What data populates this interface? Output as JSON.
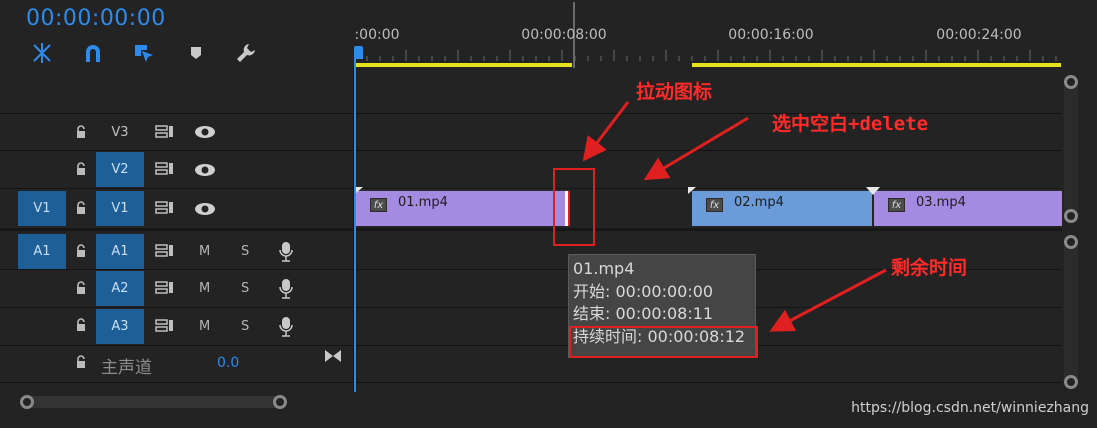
{
  "header": {
    "timecode": "00:00:00:00",
    "tools": [
      {
        "icon": "snap-insert-icon"
      },
      {
        "icon": "magnet-icon"
      },
      {
        "icon": "linked-selection-icon"
      },
      {
        "icon": "add-marker-icon"
      },
      {
        "icon": "wrench-icon"
      }
    ]
  },
  "ruler": {
    "labels": [
      ":00:00",
      "00:00:08:00",
      "00:00:16:00",
      "00:00:24:00"
    ]
  },
  "tracks": {
    "video": [
      {
        "source": "",
        "target": "V3"
      },
      {
        "source": "",
        "target": "V2"
      },
      {
        "source": "V1",
        "target": "V1"
      }
    ],
    "audio": [
      {
        "source": "A1",
        "target": "A1",
        "m": "M",
        "s": "S"
      },
      {
        "source": "",
        "target": "A2",
        "m": "M",
        "s": "S"
      },
      {
        "source": "",
        "target": "A3",
        "m": "M",
        "s": "S"
      }
    ],
    "master": {
      "label": "主声道",
      "value": "0.0"
    }
  },
  "clips": [
    {
      "name": "01.mp4",
      "fx": "fx"
    },
    {
      "name": "02.mp4",
      "fx": "fx"
    },
    {
      "name": "03.mp4",
      "fx": "fx"
    }
  ],
  "tooltip": {
    "name": "01.mp4",
    "start": "开始: 00:00:00:00",
    "end": "结束: 00:00:08:11",
    "duration": "持续时间: 00:00:08:12"
  },
  "annotations": {
    "drag_icon": "拉动图标",
    "select_blank": "选中空白+delete",
    "remaining_time": "剩余时间"
  },
  "watermark": "https://blog.csdn.net/winniezhang",
  "colors": {
    "accent": "#2d8ceb",
    "clip_purple": "#a48ae0",
    "clip_blue": "#6b9bd8",
    "annotation_red": "#e02020",
    "work_area_yellow": "#e6e31e"
  }
}
